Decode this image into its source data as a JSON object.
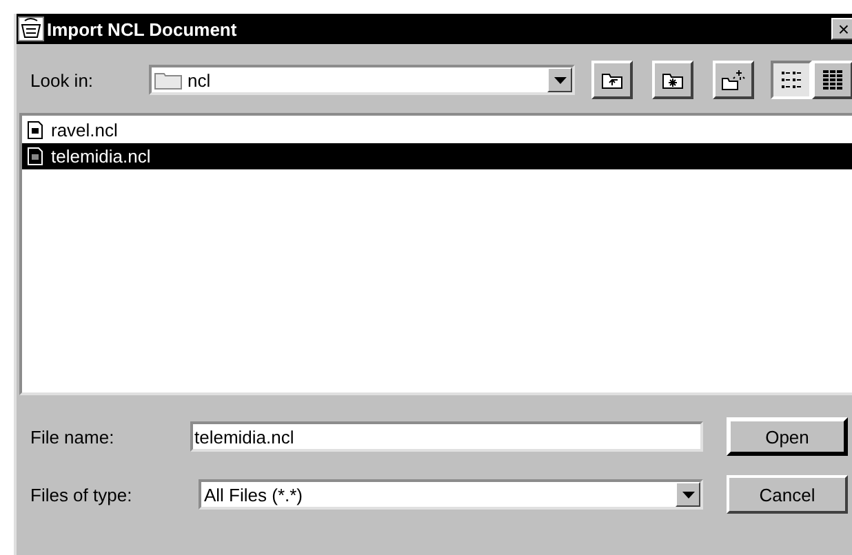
{
  "window": {
    "title": "Import NCL Document",
    "close": "×"
  },
  "look_in": {
    "label": "Look in:",
    "value": "ncl"
  },
  "toolbar": [
    {
      "kind": "up"
    },
    {
      "kind": "home"
    },
    {
      "kind": "new"
    }
  ],
  "views": [
    {
      "kind": "list",
      "selected": true
    },
    {
      "kind": "details",
      "selected": false
    }
  ],
  "files": [
    {
      "name": "ravel.ncl",
      "selected": false
    },
    {
      "name": "telemidia.ncl",
      "selected": true
    }
  ],
  "file_name": {
    "label": "File name:",
    "value": "telemidia.ncl"
  },
  "file_type": {
    "label": "Files of type:",
    "value": "All Files (*.*)"
  },
  "buttons": [
    {
      "label": "Open",
      "default": true
    },
    {
      "label": "Cancel",
      "default": false
    }
  ]
}
